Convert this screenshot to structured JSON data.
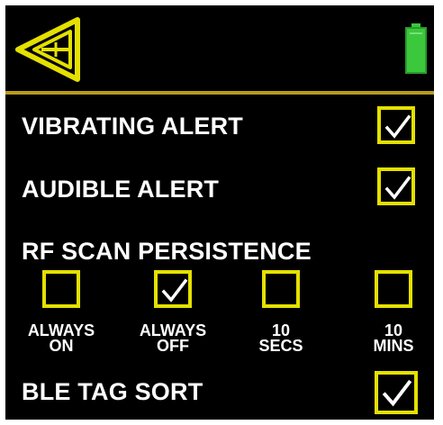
{
  "header": {
    "back_icon": "back-arrow-icon",
    "battery_icon": "battery-full-icon",
    "accent_color": "#e4e000",
    "battery_color": "#3cc83c"
  },
  "settings": {
    "vibrating_alert": {
      "label": "VIBRATING ALERT",
      "checked": true
    },
    "audible_alert": {
      "label": "AUDIBLE ALERT",
      "checked": true
    },
    "rf_scan_persistence": {
      "label": "RF SCAN PERSISTENCE",
      "options": [
        {
          "line1": "ALWAYS",
          "line2": "ON",
          "checked": false
        },
        {
          "line1": "ALWAYS",
          "line2": "OFF",
          "checked": true
        },
        {
          "line1": "10",
          "line2": "SECS",
          "checked": false
        },
        {
          "line1": "10",
          "line2": "MINS",
          "checked": false
        }
      ]
    },
    "ble_tag_sort": {
      "label": "BLE TAG SORT",
      "checked": true
    }
  }
}
